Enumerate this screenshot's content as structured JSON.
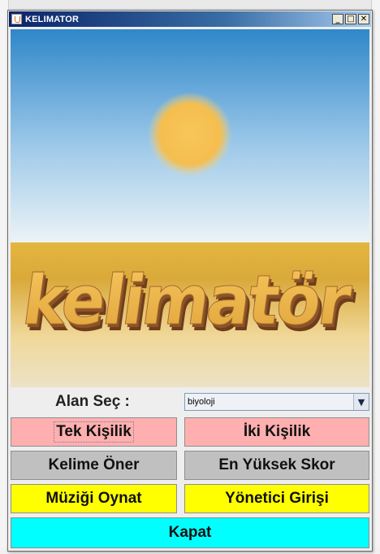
{
  "window": {
    "title": "KELIMATOR"
  },
  "window_controls": {
    "minimize": "_",
    "maximize": "□",
    "close": "✕"
  },
  "banner": {
    "logo_text": "kelimatör"
  },
  "category": {
    "label": "Alan Seç :",
    "selected": "biyoloji"
  },
  "buttons": {
    "single_player": "Tek Kişilik",
    "two_player": "İki Kişilik",
    "suggest_word": "Kelime Öner",
    "high_score": "En Yüksek Skor",
    "play_music": "Müziği Oynat",
    "admin_login": "Yönetici Girişi",
    "close": "Kapat"
  },
  "colors": {
    "pink": "#ffafaf",
    "gray": "#c0c0c0",
    "yellow": "#ffff00",
    "cyan": "#00ffff",
    "titlebar": "#0a246a"
  },
  "icons": {
    "app": "java-cup-icon",
    "dropdown": "chevron-down-icon",
    "sun": "sun"
  }
}
